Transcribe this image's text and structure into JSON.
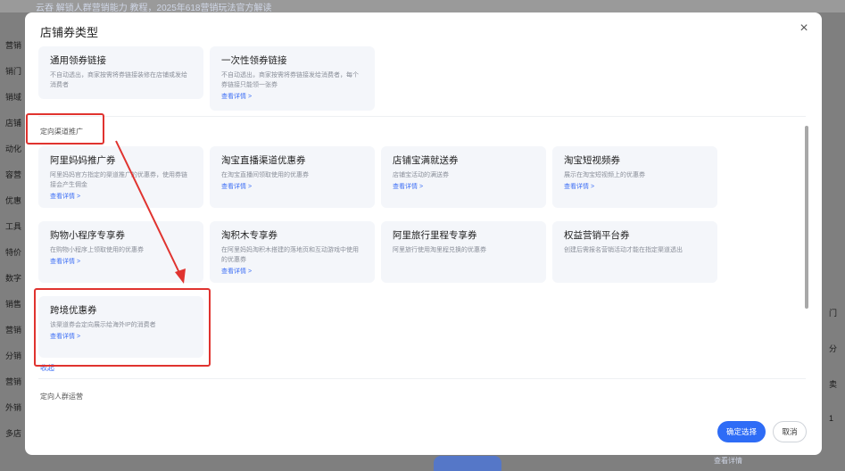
{
  "background": {
    "topbar_text": "云吞   解锁人群营销能力  教程，2025年618营销玩法官方解读",
    "left_labels": [
      "营销",
      "销门",
      "销域",
      "店铺",
      "动化",
      "容营",
      "优惠",
      "工具",
      "特价",
      "数字",
      "销售",
      "营销",
      "分销",
      "营销",
      "外销",
      "多店"
    ],
    "right_labels": [
      "门",
      "分",
      "卖",
      "1"
    ],
    "bottom_link": "查看详情"
  },
  "modal": {
    "title": "店铺券类型",
    "close_label": "×",
    "general_cards": [
      {
        "title": "通用领券链接",
        "desc": "不自动透出，商家按需将券链接装修在店铺或发给消费者",
        "link": ""
      },
      {
        "title": "一次性领券链接",
        "desc": "不自动透出，商家按需将券链接发给消费者，每个券链接只能领一张券",
        "link": "查看详情 >"
      }
    ],
    "section_channel": "定向渠道推广",
    "channel_cards_row1": [
      {
        "title": "阿里妈妈推广券",
        "desc": "阿里妈妈官方指定的渠道推广的优惠券，使用券链接会产生佣金",
        "link": "查看详情 >"
      },
      {
        "title": "淘宝直播渠道优惠券",
        "desc": "在淘宝直播间领取使用的优惠券",
        "link": "查看详情 >"
      },
      {
        "title": "店铺宝满就送券",
        "desc": "店铺宝活动的满送券",
        "link": "查看详情 >"
      },
      {
        "title": "淘宝短视频券",
        "desc": "展示在淘宝短视频上的优惠券",
        "link": "查看详情 >"
      }
    ],
    "channel_cards_row2": [
      {
        "title": "购物小程序专享券",
        "desc": "在购物小程序上领取使用的优惠券",
        "link": "查看详情 >"
      },
      {
        "title": "淘积木专享券",
        "desc": "在阿里妈妈淘积木搭建的落地页和互动游戏中使用的优惠券",
        "link": "查看详情 >"
      },
      {
        "title": "阿里旅行里程专享券",
        "desc": "阿里旅行使用淘里程兑换的优惠券",
        "link": ""
      },
      {
        "title": "权益营销平台券",
        "desc": "创建后需报名营销活动才能在指定渠道透出",
        "link": ""
      }
    ],
    "crossborder_card": {
      "title": "跨境优惠券",
      "desc": "该渠道券会定向展示给海外IP的消费者",
      "link": "查看详情 >"
    },
    "collapse_label": "收起 ⌃",
    "section_audience": "定向人群运营",
    "confirm_label": "确定选择",
    "cancel_label": "取消"
  },
  "colors": {
    "accent": "#2e6cf6",
    "annotation": "#e0332f",
    "card_bg": "#f4f6fa"
  }
}
